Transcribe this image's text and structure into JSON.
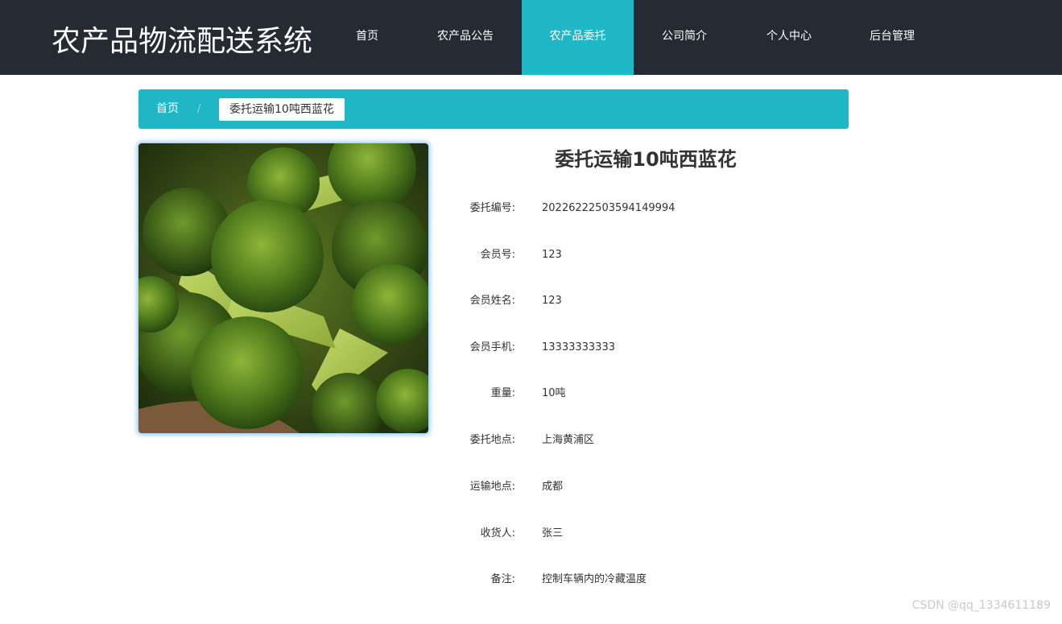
{
  "header": {
    "site_title": "农产品物流配送系统",
    "nav": [
      {
        "label": "首页"
      },
      {
        "label": "农产品公告"
      },
      {
        "label": "农产品委托",
        "active": true
      },
      {
        "label": "公司简介"
      },
      {
        "label": "个人中心"
      },
      {
        "label": "后台管理"
      }
    ]
  },
  "breadcrumb": {
    "home": "首页",
    "separator": "/",
    "current": "委托运输10吨西蓝花"
  },
  "product": {
    "image_icon": "broccoli-photo",
    "title": "委托运输10吨西蓝花",
    "fields": [
      {
        "label": "委托编号:",
        "value": "20226222503594149994"
      },
      {
        "label": "会员号:",
        "value": "123"
      },
      {
        "label": "会员姓名:",
        "value": "123"
      },
      {
        "label": "会员手机:",
        "value": "13333333333"
      },
      {
        "label": "重量:",
        "value": "10吨"
      },
      {
        "label": "委托地点:",
        "value": "上海黄浦区"
      },
      {
        "label": "运输地点:",
        "value": "成都"
      },
      {
        "label": "收货人:",
        "value": "张三"
      },
      {
        "label": "备注:",
        "value": "控制车辆内的冷藏温度"
      }
    ]
  },
  "watermark": "CSDN @qq_1334611189",
  "colors": {
    "topbar": "#262a33",
    "accent": "#1fb6c6",
    "text": "#333333"
  }
}
